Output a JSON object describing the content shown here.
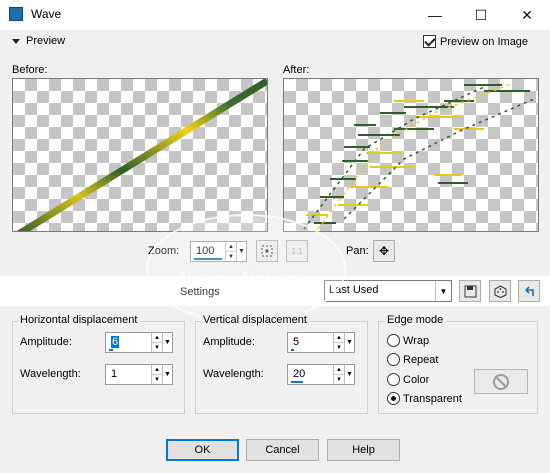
{
  "window": {
    "title": "Wave",
    "minimize_glyph": "—",
    "maximize_glyph": "☐",
    "close_glyph": "✕"
  },
  "preview": {
    "toggle_label": "Preview",
    "preview_on_image_label": "Preview on Image",
    "preview_on_image_checked": true,
    "before_label": "Before:",
    "after_label": "After:"
  },
  "zoom": {
    "label": "Zoom:",
    "value": "100",
    "fit_icon": "zoom-fit-icon",
    "actual_icon": "zoom-1-to-1-icon",
    "actual_glyph": "1:1"
  },
  "pan": {
    "label": "Pan:",
    "icon": "move-arrows-icon",
    "glyph": "✥"
  },
  "watermark": {
    "text": "Neusa Novaes"
  },
  "settings": {
    "label": "Settings",
    "preset_value": "Last Used",
    "save_icon": "save-floppy-icon",
    "randomize_icon": "dice-icon",
    "reset_icon": "undo-arrow-icon"
  },
  "horizontal": {
    "title": "Horizontal displacement",
    "amplitude_label": "Amplitude:",
    "amplitude_value": "6",
    "wavelength_label": "Wavelength:",
    "wavelength_value": "1"
  },
  "vertical": {
    "title": "Vertical displacement",
    "amplitude_label": "Amplitude:",
    "amplitude_value": "5",
    "wavelength_label": "Wavelength:",
    "wavelength_value": "20"
  },
  "edge_mode": {
    "title": "Edge mode",
    "options": [
      "Wrap",
      "Repeat",
      "Color",
      "Transparent"
    ],
    "selected": "Transparent",
    "color_swatch_icon": "no-color-icon"
  },
  "buttons": {
    "ok": "OK",
    "cancel": "Cancel",
    "help": "Help"
  },
  "colors": {
    "accent": "#0078d7",
    "stroke_dark_green": "#2e5e2a",
    "stroke_yellow": "#e8c81a"
  }
}
